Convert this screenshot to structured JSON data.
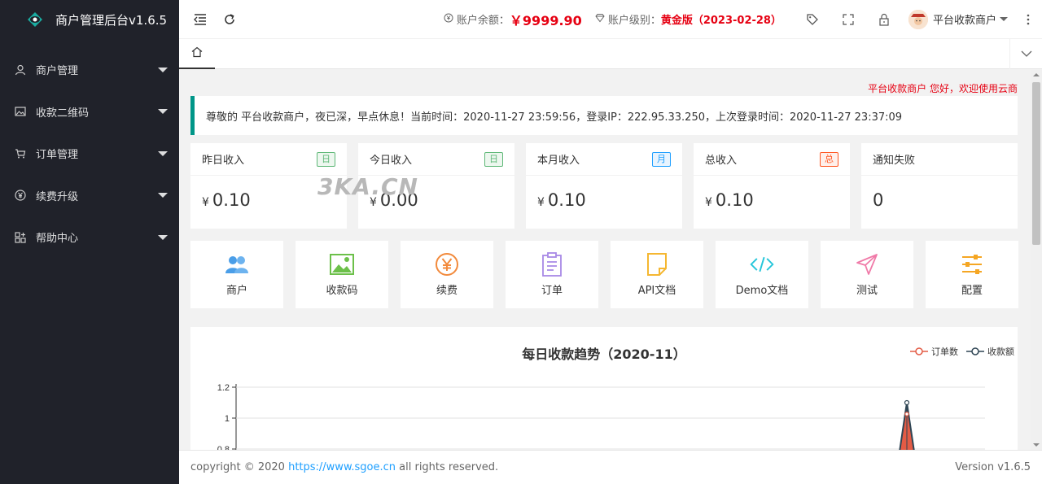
{
  "app": {
    "title": "商户管理后台v1.6.5"
  },
  "sidebar": {
    "items": [
      {
        "label": "商户管理",
        "icon": "user-icon"
      },
      {
        "label": "收款二维码",
        "icon": "image-icon"
      },
      {
        "label": "订单管理",
        "icon": "cart-icon"
      },
      {
        "label": "续费升级",
        "icon": "yen-circle-icon"
      },
      {
        "label": "帮助中心",
        "icon": "apps-icon"
      }
    ]
  },
  "header": {
    "balance_label": "账户余额：",
    "balance_value": "￥9999.90",
    "level_label": "账户级别：",
    "level_value": "黄金版（2023-02-28）",
    "user_name": "平台收款商户"
  },
  "main": {
    "marquee": "平台收款商户 您好，欢迎使用云商",
    "notice": "尊敬的 平台收款商户，夜已深，早点休息！当前时间：2020-11-27 23:59:56，登录IP：222.95.33.250，上次登录时间：2020-11-27 23:37:09",
    "watermark": "3KA.CN",
    "stats": [
      {
        "label": "昨日收入",
        "badge": "日",
        "badge_color": "green",
        "currency": "¥",
        "value": "0.10"
      },
      {
        "label": "今日收入",
        "badge": "日",
        "badge_color": "green",
        "currency": "¥",
        "value": "0.00"
      },
      {
        "label": "本月收入",
        "badge": "月",
        "badge_color": "blue",
        "currency": "¥",
        "value": "0.10"
      },
      {
        "label": "总收入",
        "badge": "总",
        "badge_color": "red",
        "currency": "¥",
        "value": "0.10"
      },
      {
        "label": "通知失败",
        "badge": "",
        "badge_color": "",
        "currency": "",
        "value": "0"
      }
    ],
    "shortcuts": [
      {
        "label": "商户",
        "icon": "users-icon",
        "color": "#4a9ee8"
      },
      {
        "label": "收款码",
        "icon": "picture-icon",
        "color": "#6cc04a"
      },
      {
        "label": "续费",
        "icon": "yen-icon",
        "color": "#f28a3c"
      },
      {
        "label": "订单",
        "icon": "clipboard-icon",
        "color": "#a889e6"
      },
      {
        "label": "API文档",
        "icon": "note-icon",
        "color": "#f5b731"
      },
      {
        "label": "Demo文档",
        "icon": "code-icon",
        "color": "#26c6da"
      },
      {
        "label": "测试",
        "icon": "send-icon",
        "color": "#f07aa8"
      },
      {
        "label": "配置",
        "icon": "sliders-icon",
        "color": "#f5a623"
      }
    ]
  },
  "chart_data": {
    "type": "line",
    "title": "每日收款趋势（2020-11）",
    "series": [
      {
        "name": "订单数",
        "color": "#e35b45"
      },
      {
        "name": "收款额",
        "color": "#2f4554"
      }
    ],
    "y_ticks": [
      "1.2",
      "1",
      "0.8"
    ],
    "ylim": [
      0.8,
      1.2
    ],
    "peak_value": 1.1,
    "grid": true,
    "legend": "top-right"
  },
  "footer": {
    "copyright_prefix": "copyright © 2020 ",
    "link_text": "https://www.sgoe.cn",
    "copyright_suffix": " all rights reserved.",
    "version": "Version v1.6.5"
  }
}
